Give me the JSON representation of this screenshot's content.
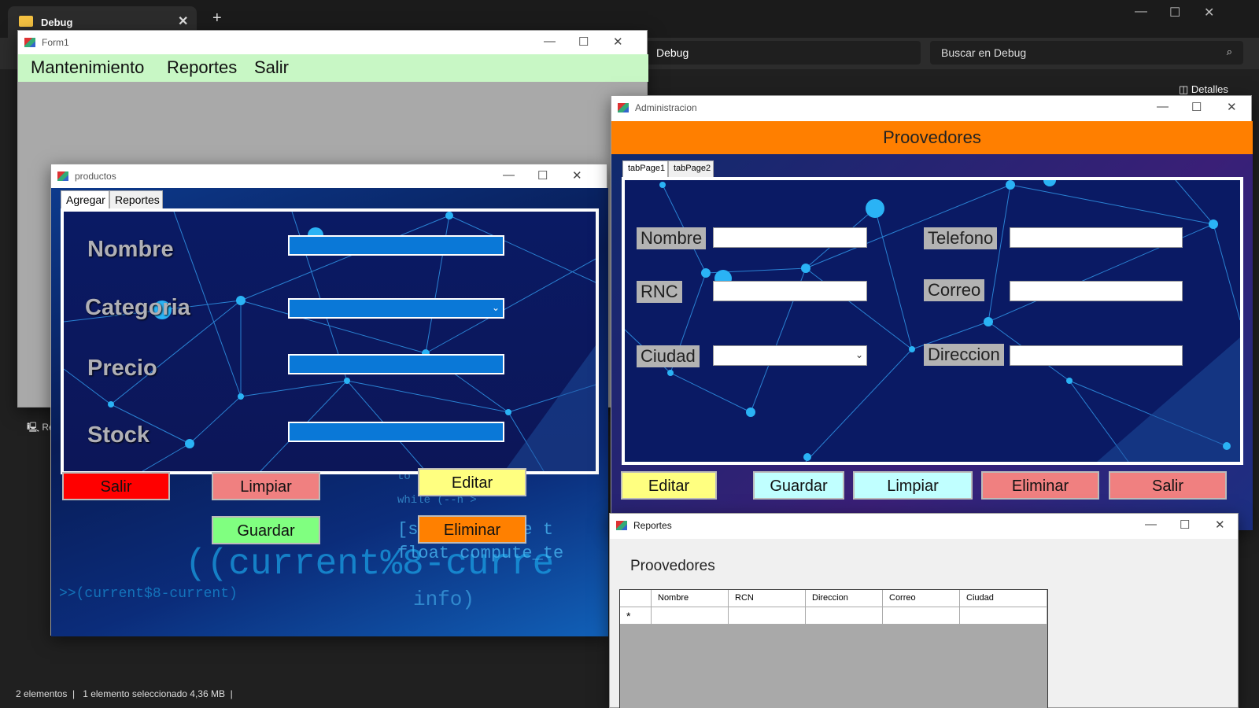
{
  "explorer": {
    "tab_title": "Debug",
    "tab_close": "✕",
    "new_tab": "+",
    "path": "Debug",
    "search_placeholder": "Buscar en Debug",
    "details": "Detalles",
    "status_items": "2 elementos",
    "status_selected": "1 elemento seleccionado",
    "status_size": "4,36 MB",
    "nav_item": "Re"
  },
  "form1": {
    "title": "Form1",
    "menu": [
      "Mantenimiento",
      "Reportes",
      "Salir"
    ]
  },
  "productos": {
    "title": "productos",
    "tabs": [
      "Agregar",
      "Reportes"
    ],
    "labels": [
      "Nombre",
      "Categoria",
      "Precio",
      "Stock"
    ],
    "buttons": {
      "salir": "Salir",
      "limpiar": "Limpiar",
      "editar": "Editar",
      "guardar": "Guardar",
      "eliminar": "Eliminar"
    }
  },
  "admin": {
    "title": "Administracion",
    "header": "Proovedores",
    "tabs": [
      "tabPage1",
      "tabPage2"
    ],
    "labels": [
      "Nombre",
      "RNC",
      "Ciudad",
      "Telefono",
      "Correo",
      "Direccion"
    ],
    "buttons": {
      "editar": "Editar",
      "guardar": "Guardar",
      "limpiar": "Limpiar",
      "eliminar": "Eliminar",
      "salir": "Salir"
    }
  },
  "reportes": {
    "title": "Reportes",
    "heading": "Proovedores",
    "columns": [
      "Nombre",
      "RCN",
      "Direccion",
      "Correo",
      "Ciudad"
    ],
    "new_row_marker": "*"
  },
  "colors": {
    "form1_menu": "#c8f7c5",
    "admin_header": "#ff7f00",
    "btn_red": "#ff0000",
    "btn_pink": "#f08080",
    "btn_yellow": "#ffff80",
    "btn_green": "#80ff80",
    "btn_orange": "#ff8000",
    "btn_cyan": "#c0ffff"
  }
}
